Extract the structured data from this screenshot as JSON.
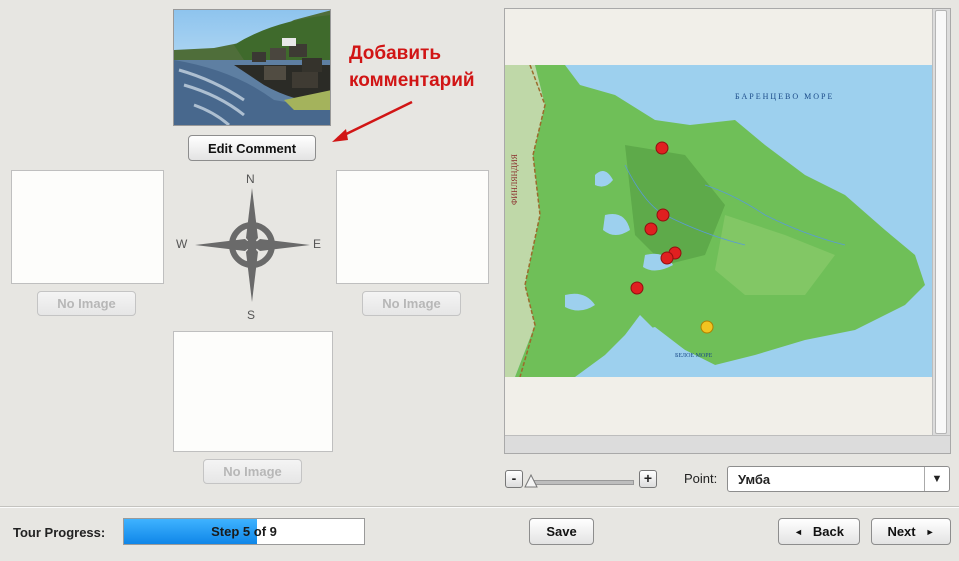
{
  "annotation": {
    "text": "Добавить\nкомментарий",
    "color": "#d11515"
  },
  "photos": {
    "top_button": "Edit Comment",
    "west_button": "No Image",
    "east_button": "No Image",
    "south_button": "No Image"
  },
  "compass": {
    "n": "N",
    "s": "S",
    "w": "W",
    "e": "E"
  },
  "map": {
    "sea_label": "БАРЕНЦЕВО МОРЕ",
    "white_sea_label": "БЕЛОЕ МОРЕ",
    "country_label": "ФИНЛЯНДИЯ",
    "selected_marker_color": "#f2c420",
    "marker_color": "#e02020"
  },
  "zoom": {
    "minus": "-",
    "plus": "+",
    "level": 0.0
  },
  "point": {
    "label": "Point:",
    "value": "Умба",
    "arrow": "▼"
  },
  "progress": {
    "label": "Tour Progress:",
    "text": "Step 5 of 9",
    "fraction": 0.5556
  },
  "footer": {
    "save": "Save",
    "back": "Back",
    "next": "Next",
    "back_icon": "◄",
    "next_icon": "►"
  }
}
